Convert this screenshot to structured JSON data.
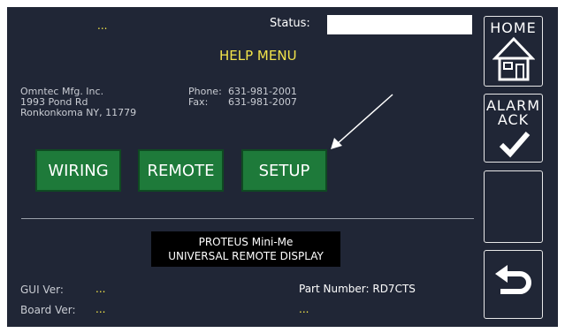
{
  "header": {
    "left_value": "...",
    "status_label": "Status:"
  },
  "page_title": "HELP MENU",
  "contact": {
    "company": "Omntec Mfg. Inc.",
    "address_line1": "1993 Pond Rd",
    "address_line2": "Ronkonkoma NY, 11779",
    "phone_label": "Phone:",
    "phone_value": "631-981-2001",
    "fax_label": "Fax:",
    "fax_value": "631-981-2007"
  },
  "menu_buttons": {
    "wiring": "WIRING",
    "remote": "REMOTE",
    "setup": "SETUP"
  },
  "product": {
    "line1": "PROTEUS Mini-Me",
    "line2": "UNIVERSAL REMOTE DISPLAY"
  },
  "versions": {
    "gui_label": "GUI Ver:",
    "gui_value": "...",
    "board_label": "Board Ver:",
    "board_value": "...",
    "part_label": "Part Number: RD7CTS",
    "part_value": "..."
  },
  "side_buttons": {
    "home": "HOME",
    "alarm_line1": "ALARM",
    "alarm_line2": "ACK"
  },
  "icons": {
    "home": "house-icon",
    "alarm": "checkmark-icon",
    "back": "back-arrow-icon",
    "pointer": "arrow-pointer-icon"
  },
  "colors": {
    "screen_bg": "#202636",
    "accent_yellow": "#f2e44a",
    "button_green": "#1e7a3a",
    "status_box": "#ffffff"
  }
}
